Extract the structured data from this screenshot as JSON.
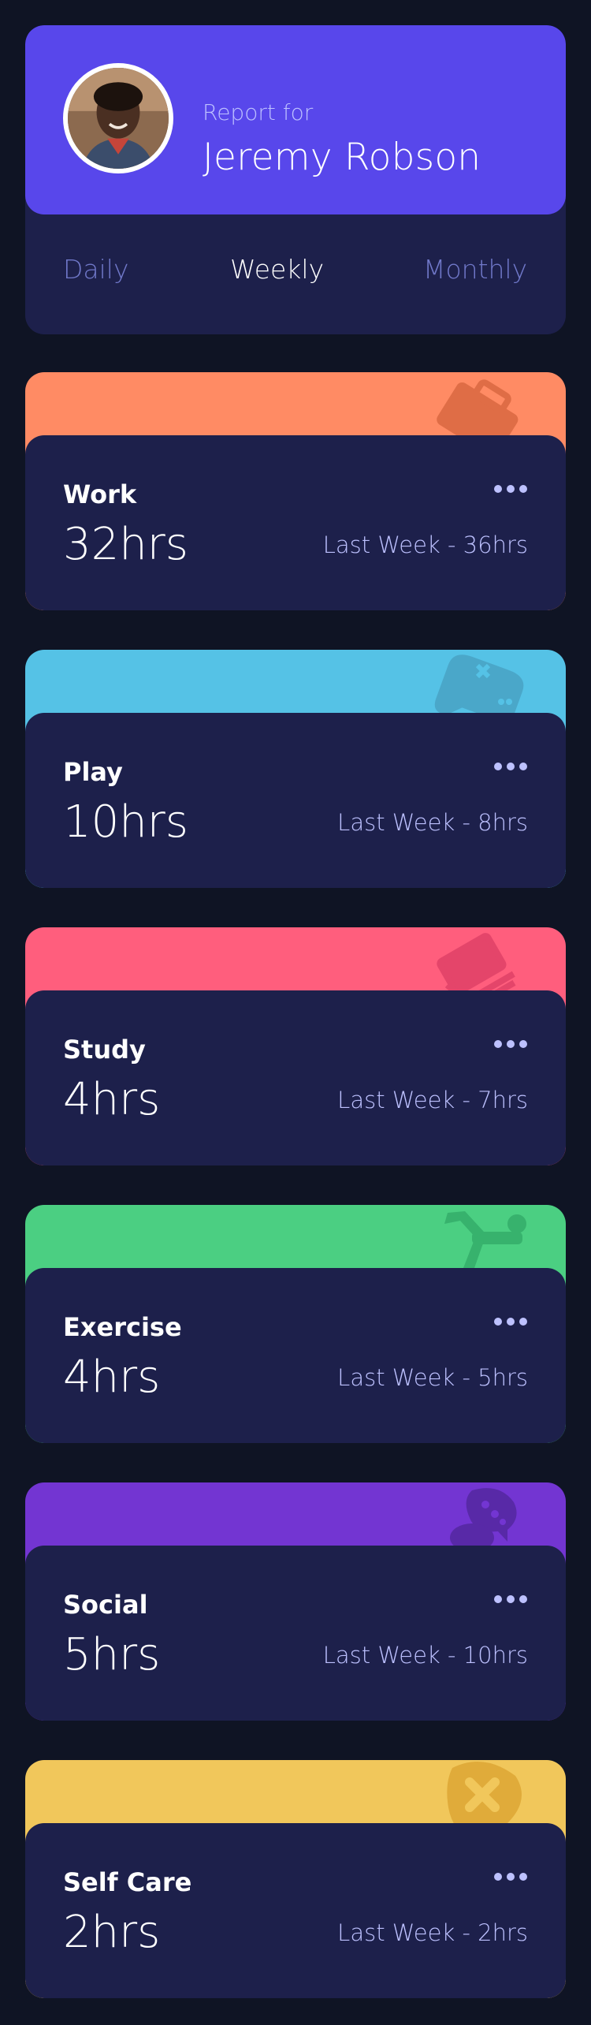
{
  "profile": {
    "report_label": "Report for",
    "name": "Jeremy Robson"
  },
  "timeframes": [
    {
      "label": "Daily",
      "active": false
    },
    {
      "label": "Weekly",
      "active": true
    },
    {
      "label": "Monthly",
      "active": false
    }
  ],
  "activities": [
    {
      "title": "Work",
      "current": "32hrs",
      "previous": "Last Week - 36hrs",
      "color": "#ff8b64",
      "icon": "briefcase-icon"
    },
    {
      "title": "Play",
      "current": "10hrs",
      "previous": "Last Week - 8hrs",
      "color": "#55c2e6",
      "icon": "gamepad-icon"
    },
    {
      "title": "Study",
      "current": "4hrs",
      "previous": "Last Week - 7hrs",
      "color": "#ff5e7d",
      "icon": "books-icon"
    },
    {
      "title": "Exercise",
      "current": "4hrs",
      "previous": "Last Week - 5hrs",
      "color": "#4bcf82",
      "icon": "running-icon"
    },
    {
      "title": "Social",
      "current": "5hrs",
      "previous": "Last Week - 10hrs",
      "color": "#7335d2",
      "icon": "chat-icon"
    },
    {
      "title": "Self Care",
      "current": "2hrs",
      "previous": "Last Week - 2hrs",
      "color": "#f1c75b",
      "icon": "heart-bandage-icon"
    }
  ],
  "colors": {
    "background": "#0f1424",
    "card": "#1d204b",
    "accent": "#5847eb",
    "muted_text": "#bdc1ff",
    "inactive_tab": "#7078c9"
  }
}
